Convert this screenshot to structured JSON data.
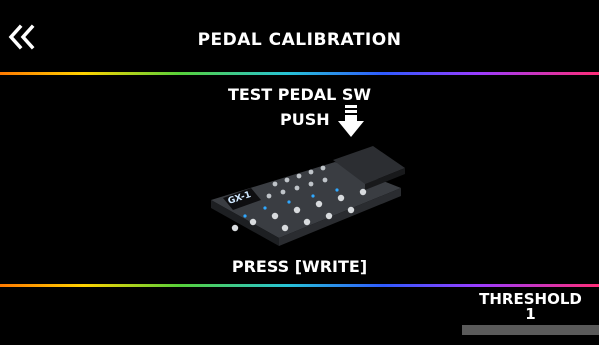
{
  "header": {
    "back_icon": "double-chevron-left-icon",
    "title": "PEDAL CALIBRATION"
  },
  "main": {
    "instruction_test": "TEST PEDAL SW",
    "push_label": "PUSH",
    "push_icon": "down-arrow-icon",
    "instruction_write": "PRESS [WRITE]",
    "device_label": "GX-1"
  },
  "threshold": {
    "label": "THRESHOLD",
    "value": "1"
  }
}
